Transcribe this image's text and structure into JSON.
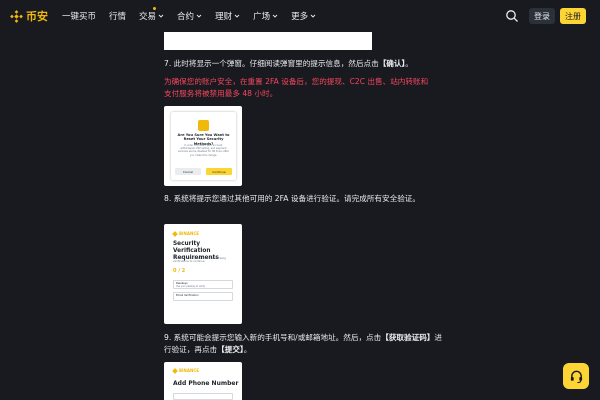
{
  "header": {
    "logo_text": "币安",
    "nav": [
      {
        "label": "一键买币",
        "dropdown": false
      },
      {
        "label": "行情",
        "dropdown": false
      },
      {
        "label": "交易",
        "dropdown": true
      },
      {
        "label": "合约",
        "dropdown": true
      },
      {
        "label": "理财",
        "dropdown": true
      },
      {
        "label": "广场",
        "dropdown": true
      },
      {
        "label": "更多",
        "dropdown": true
      }
    ],
    "login_label": "登录",
    "register_label": "注册"
  },
  "steps": {
    "step7_prefix": "7. 此时将显示一个弹窗。仔细阅读弹窗里的提示信息，然后点击",
    "step7_bold": "【确认】",
    "step7_suffix": "。",
    "warning": "为确保您的账户安全，在重置 2FA 设备后，您的提现、C2C 出售、站内转账和支付服务将被禁用最多 48 小时。",
    "step8": "8. 系统将提示您通过其他可用的 2FA 设备进行验证。请完成所有安全验证。",
    "step9_prefix": "9. 系统可能会提示您输入新的手机号和/或邮箱地址。然后，点击",
    "step9_bold1": "【获取验证码】",
    "step9_middle": "进行验证，再点击",
    "step9_bold2": "【提交】",
    "step9_suffix": "。"
  },
  "dialog_shot": {
    "title": "Are You Sure You Want to Reset Your Security Methods?",
    "body": "In order to protect your account, withdrawals, P2P selling, and payment services will be disabled for 48 hours after you make this change.",
    "cancel": "Cancel",
    "continue": "Continue"
  },
  "verify_shot": {
    "brand": "BINANCE",
    "title": "Security Verification Requirements",
    "desc": "You need to complete all of the following verifications to continue.",
    "count": "0 / 2",
    "item1": "Passkeys",
    "item1_sub": "Use your passkey to verify",
    "item2": "Email Verification"
  },
  "phone_shot": {
    "brand": "BINANCE",
    "title": "Add Phone Number"
  },
  "colors": {
    "background": "#181a20",
    "accent": "#fcd535",
    "warning": "#f6465d"
  },
  "icons": {
    "search": "search-icon",
    "support": "headset-icon",
    "logo": "binance-logo-icon"
  }
}
